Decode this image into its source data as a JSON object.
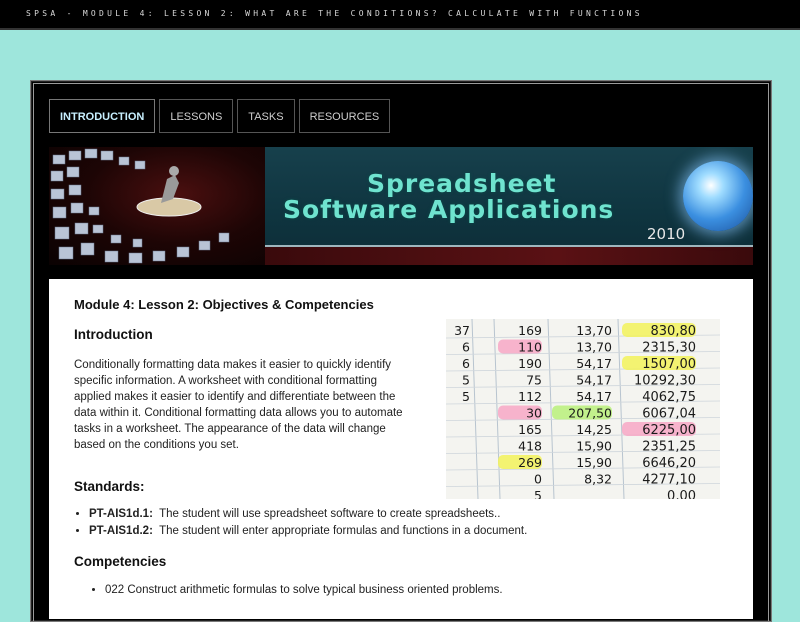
{
  "header": {
    "title": "SPSA - MODULE 4: LESSON 2: WHAT ARE THE CONDITIONS? CALCULATE WITH FUNCTIONS"
  },
  "nav": {
    "tabs": [
      {
        "label": "INTRODUCTION",
        "active": true
      },
      {
        "label": "LESSONS",
        "active": false
      },
      {
        "label": "TASKS",
        "active": false
      },
      {
        "label": "RESOURCES",
        "active": false
      }
    ]
  },
  "banner": {
    "title_line1": "Spreadsheet",
    "title_line2": "Software Applications",
    "year": "2010"
  },
  "content": {
    "module_title": "Module 4: Lesson 2: Objectives & Competencies",
    "intro_heading": "Introduction",
    "intro_text": "Conditionally formatting data makes it easier to quickly identify specific information. A worksheet with conditional formatting applied makes it easier to identify and differentiate between the data within it. Conditional formatting data allows you to automate tasks in a worksheet. The appearance of the data will change based on the conditions you set.",
    "standards_heading": "Standards:",
    "standards": [
      {
        "code": "PT-AIS1d.1:",
        "text": "The student will use spreadsheet software to create spreadsheets.."
      },
      {
        "code": "PT-AIS1d.2:",
        "text": "The student will enter appropriate formulas and functions in a document."
      }
    ],
    "competencies_heading": "Competencies",
    "competencies": [
      "022 Construct arithmetic formulas to solve typical business oriented problems."
    ]
  },
  "spreadsheet_image": {
    "rows": [
      [
        "37",
        "169",
        "13,70",
        "830,80"
      ],
      [
        "6",
        "110",
        "13,70",
        "2315,30"
      ],
      [
        "6",
        "190",
        "54,17",
        "1507,00"
      ],
      [
        "5",
        "75",
        "54,17",
        "10292,30"
      ],
      [
        "5",
        "112",
        "54,17",
        "4062,75"
      ],
      [
        "",
        "30",
        "207,50",
        "6067,04"
      ],
      [
        "",
        "165",
        "14,25",
        "6225,00"
      ],
      [
        "",
        "418",
        "15,90",
        "2351,25"
      ],
      [
        "",
        "269",
        "15,90",
        "6646,20"
      ],
      [
        "",
        "0",
        "8,32",
        "4277,10"
      ],
      [
        "",
        "5",
        "",
        "0,00"
      ]
    ],
    "highlight_colors": {
      "green": "#b8f07a",
      "pink": "#f7a7c6",
      "yellow": "#f2f25a"
    }
  },
  "colors": {
    "page_bg": "#9ee6dc",
    "frame_bg": "#000000",
    "banner_text": "#6fe3cf"
  }
}
